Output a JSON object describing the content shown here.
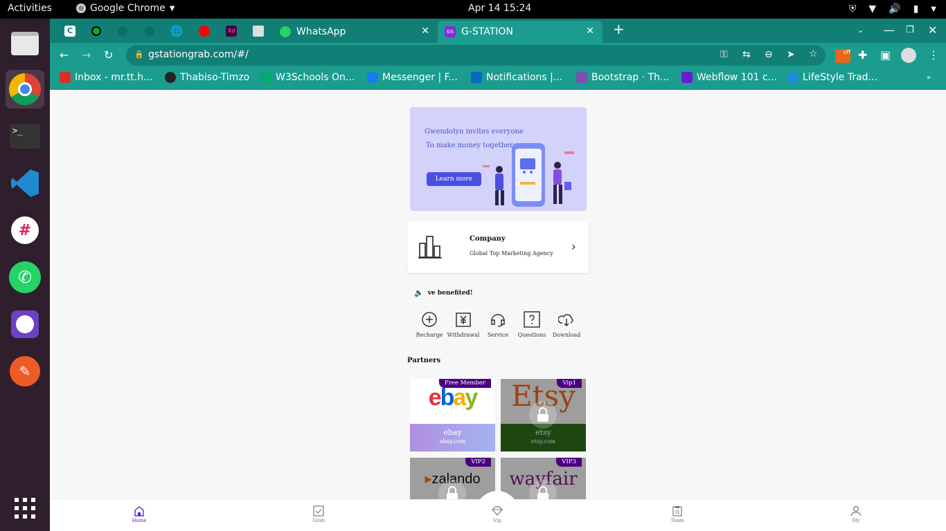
{
  "os": {
    "activities": "Activities",
    "app_name": "Google Chrome",
    "clock": "Apr 14  15:24"
  },
  "browser": {
    "tabs": [
      {
        "label": "WhatsApp"
      },
      {
        "label": "G-STATION"
      }
    ],
    "url": "gstationgrab.com/#/",
    "bookmarks": [
      "Inbox - mr.tt.h...",
      "Thabiso-Timzo",
      "W3Schools On...",
      "Messenger | F...",
      "Notifications |...",
      "Bootstrap · Th...",
      "Webflow 101 c...",
      "LifeStyle Trad..."
    ]
  },
  "page": {
    "banner": {
      "line1": "Gwendolyn invites everyone",
      "line2": "To make money together",
      "button": "Learn more"
    },
    "company": {
      "title": "Company",
      "subtitle": "Global Top Marketing Agency"
    },
    "notice": "ve benefited!",
    "quick_actions": [
      "Recharge",
      "Withdrawal",
      "Service",
      "Questions",
      "Download"
    ],
    "partners_title": "Partners",
    "partners": [
      {
        "badge": "Free Member",
        "name": "ebay",
        "domain": "ebay.com",
        "logo": "ebay",
        "locked": false
      },
      {
        "badge": "Vip1",
        "name": "etsy",
        "domain": "etsy.com",
        "logo": "Etsy",
        "locked": true
      },
      {
        "badge": "VIP2",
        "name": "zalando",
        "domain": "",
        "logo": "zalando",
        "locked": true
      },
      {
        "badge": "VIP3",
        "name": "wayfair",
        "domain": "",
        "logo": "wayfair",
        "locked": true
      }
    ],
    "tabbar": [
      "Home",
      "Grab",
      "Vip",
      "Team",
      "My"
    ]
  },
  "colors": {
    "browser_accent": "#1b9c8f",
    "brand_purple": "#5b29c7",
    "badge": "#4b0082"
  }
}
